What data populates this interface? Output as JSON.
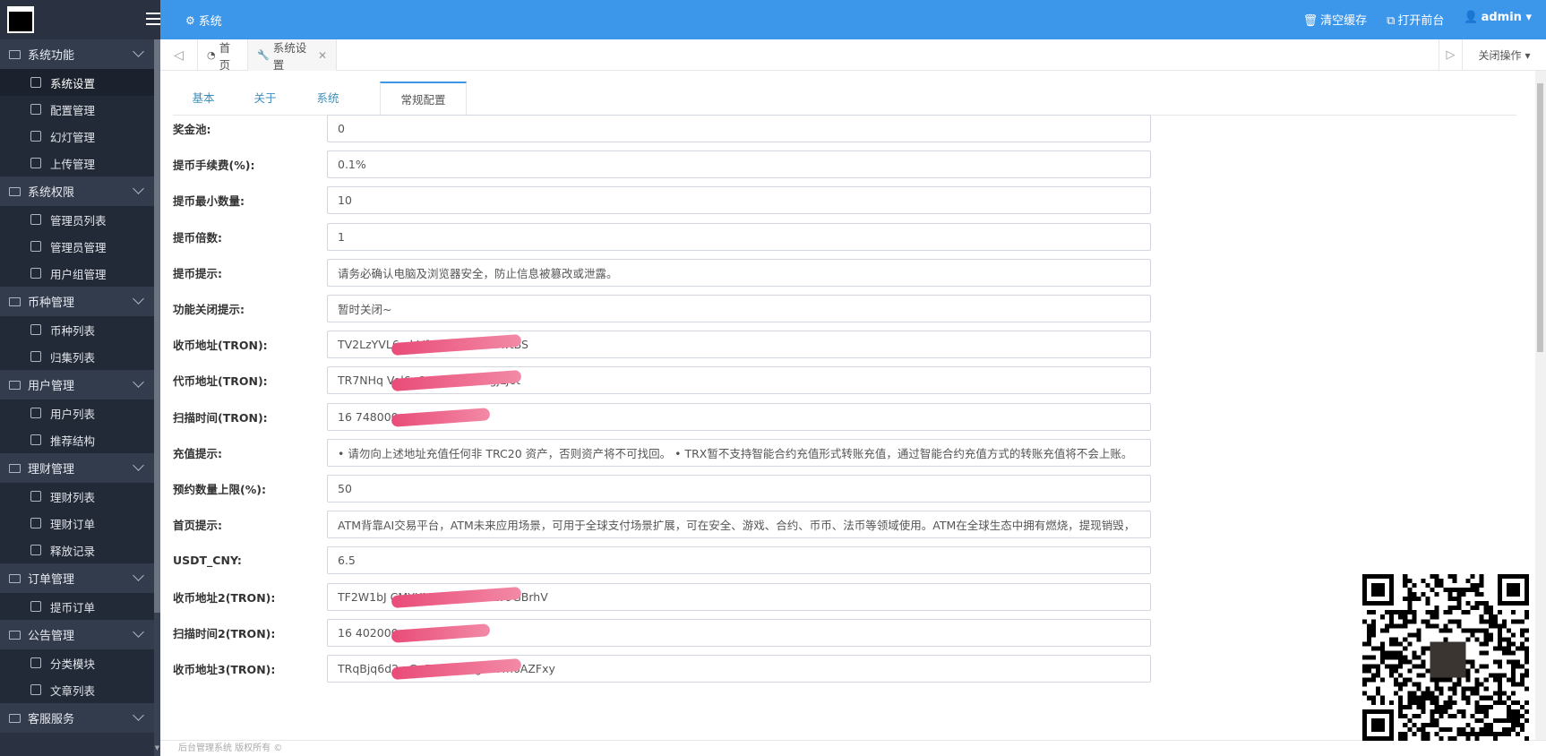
{
  "sidebar": {
    "groups": [
      {
        "label": "系统功能",
        "items": [
          {
            "label": "系统设置",
            "active": true
          },
          {
            "label": "配置管理"
          },
          {
            "label": "幻灯管理"
          },
          {
            "label": "上传管理"
          }
        ]
      },
      {
        "label": "系统权限",
        "items": [
          {
            "label": "管理员列表"
          },
          {
            "label": "管理员管理"
          },
          {
            "label": "用户组管理"
          }
        ]
      },
      {
        "label": "币种管理",
        "items": [
          {
            "label": "币种列表"
          },
          {
            "label": "归集列表"
          }
        ]
      },
      {
        "label": "用户管理",
        "items": [
          {
            "label": "用户列表"
          },
          {
            "label": "推荐结构"
          }
        ]
      },
      {
        "label": "理财管理",
        "items": [
          {
            "label": "理财列表"
          },
          {
            "label": "理财订单"
          },
          {
            "label": "释放记录"
          }
        ]
      },
      {
        "label": "订单管理",
        "items": [
          {
            "label": "提币订单"
          }
        ]
      },
      {
        "label": "公告管理",
        "items": [
          {
            "label": "分类模块"
          },
          {
            "label": "文章列表"
          }
        ]
      },
      {
        "label": "客服服务",
        "items": []
      }
    ]
  },
  "topbar": {
    "crumb": "系统",
    "clear_cache": "清空缓存",
    "open_front": "打开前台",
    "user": "admin"
  },
  "tabsbar": {
    "home": "首页",
    "current": "系统设置",
    "close_ops": "关闭操作"
  },
  "content_tabs": [
    "基本",
    "关于",
    "系统",
    "常规配置"
  ],
  "form": [
    {
      "label": "奖金池:",
      "value": "0"
    },
    {
      "label": "提币手续费(%):",
      "value": "0.1%"
    },
    {
      "label": "提币最小数量:",
      "value": "10"
    },
    {
      "label": "提币倍数:",
      "value": "1"
    },
    {
      "label": "提币提示:",
      "value": "请务必确认电脑及浏览器安全，防止信息被篡改或泄露。"
    },
    {
      "label": "功能关闭提示:",
      "value": "暂时关闭~"
    },
    {
      "label": "收币地址(TRON):",
      "value": "TV2LzYVL6              qbVfuRz9TmcDtYwtBS"
    },
    {
      "label": "代币地址(TRON):",
      "value": "TR7NHq                Vel6q6z14pz8otSzgjLj6t"
    },
    {
      "label": "扫描时间(TRON):",
      "value": "16        748000"
    },
    {
      "label": "充值提示:",
      "value": "• 请勿向上述地址充值任何非 TRC20 资产，否则资产将不可找回。     • TRX暂不支持智能合约充值形式转账充值，通过智能合约充值方式的转账充值将不会上账。"
    },
    {
      "label": "预约数量上限(%):",
      "value": "50"
    },
    {
      "label": "首页提示:",
      "value": "ATM背靠AI交易平台，ATM未来应用场景，可用于全球支付场景扩展，可在安全、游戏、合约、币币、法币等领域使用。ATM在全球生态中拥有燃烧，提现销毁，"
    },
    {
      "label": "USDT_CNY:",
      "value": "6.5"
    },
    {
      "label": "收币地址2(TRON):",
      "value": "TF2W1bJ          CMYXMgckxYGWRLV9GBrhV"
    },
    {
      "label": "扫描时间2(TRON):",
      "value": "16        402000"
    },
    {
      "label": "收币地址3(TRON):",
      "value": "TRqBjq6d2          xGpF6BBkX9gUtVm6AZFxy"
    }
  ],
  "footer": "后台管理系统 版权所有 ©"
}
